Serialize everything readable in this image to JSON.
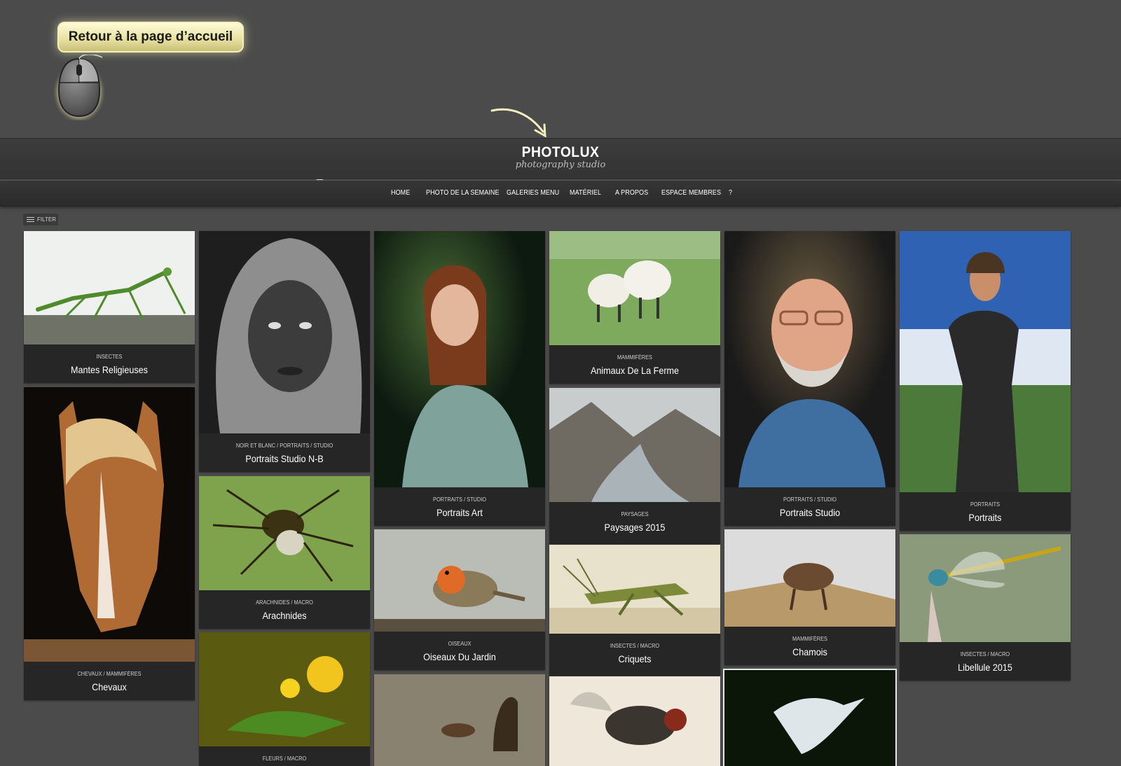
{
  "annotation": {
    "back_button_label": "Retour à la page d’accueil"
  },
  "header": {
    "brand_title": "PHOTOLUX",
    "brand_subtitle": "photography studio"
  },
  "nav": {
    "items": [
      {
        "label": "HOME"
      },
      {
        "label": "PHOTO DE LA SEMAINE"
      },
      {
        "label": "GALERIES MENU"
      },
      {
        "label": "MATÉRIEL"
      },
      {
        "label": "A PROPOS"
      },
      {
        "label": "ESPACE MEMBRES"
      },
      {
        "label": "?"
      }
    ]
  },
  "filter": {
    "label": "FILTER"
  },
  "galleries": [
    {
      "category": "INSECTES",
      "title": "Mantes Religieuses",
      "subject": "mantis-photo"
    },
    {
      "category": "CHEVAUX / MAMMIFÈRES",
      "title": "Chevaux",
      "subject": "horse-photo"
    },
    {
      "category": "NOIR ET BLANC / PORTRAITS / STUDIO",
      "title": "Portraits Studio N-B",
      "subject": "bw-portrait-photo"
    },
    {
      "category": "ARACHNIDES / MACRO",
      "title": "Arachnides",
      "subject": "spider-photo"
    },
    {
      "category": "FLEURS / MACRO",
      "title": "",
      "subject": "flowers-photo"
    },
    {
      "category": "PORTRAITS / STUDIO",
      "title": "Portraits Art",
      "subject": "art-portrait-photo"
    },
    {
      "category": "OISEAUX",
      "title": "Oiseaux Du Jardin",
      "subject": "robin-photo"
    },
    {
      "category": "",
      "title": "",
      "subject": "beaver-photo"
    },
    {
      "category": "MAMMIFÈRES",
      "title": "Animaux De La Ferme",
      "subject": "sheep-photo"
    },
    {
      "category": "PAYSAGES",
      "title": "Paysages 2015",
      "subject": "landscape-photo"
    },
    {
      "category": "INSECTES / MACRO",
      "title": "Criquets",
      "subject": "grasshopper-photo"
    },
    {
      "category": "",
      "title": "",
      "subject": "fly-photo"
    },
    {
      "category": "PORTRAITS / STUDIO",
      "title": "Portraits Studio",
      "subject": "man-portrait-photo"
    },
    {
      "category": "MAMMIFÈRES",
      "title": "Chamois",
      "subject": "chamois-photo"
    },
    {
      "category": "",
      "title": "",
      "subject": "heron-photo"
    },
    {
      "category": "PORTRAITS",
      "title": "Portraits",
      "subject": "outdoor-portrait-photo"
    },
    {
      "category": "INSECTES / MACRO",
      "title": "Libellule 2015",
      "subject": "dragonfly-photo"
    }
  ],
  "colors": {
    "page_bg": "#4b4b4b",
    "card_bg": "#262626",
    "callout_yellow": "#e9e2a3"
  }
}
